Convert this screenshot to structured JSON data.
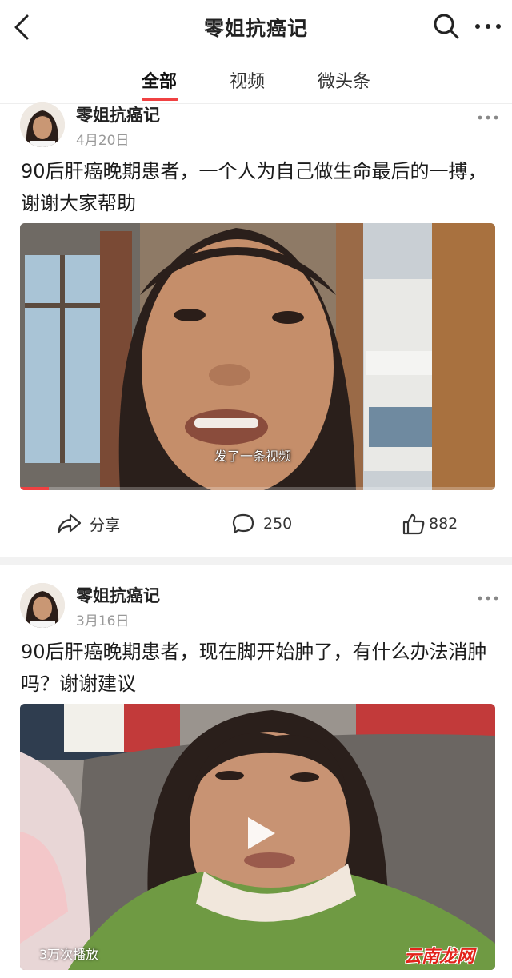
{
  "header": {
    "title": "零姐抗癌记",
    "back_icon": "back-chevron-icon",
    "search_icon": "search-icon",
    "more_icon": "more-dots-icon"
  },
  "tabs": [
    {
      "label": "全部",
      "active": true
    },
    {
      "label": "视频",
      "active": false
    },
    {
      "label": "微头条",
      "active": false
    }
  ],
  "accent_color": "#f04142",
  "posts": [
    {
      "author": "零姐抗癌记",
      "date": "4月20日",
      "text": "90后肝癌晚期患者，一个人为自己做生命最后的一搏，谢谢大家帮助",
      "video_caption": "发了一条视频",
      "actions": {
        "share_label": "分享",
        "comment_count": "250",
        "like_count": "882"
      }
    },
    {
      "author": "零姐抗癌记",
      "date": "3月16日",
      "text": "90后肝癌晚期患者，现在脚开始肿了，有什么办法消肿吗？谢谢建议",
      "views": "3万次播放",
      "play_icon": "play-icon"
    }
  ],
  "watermark": "云南龙网"
}
